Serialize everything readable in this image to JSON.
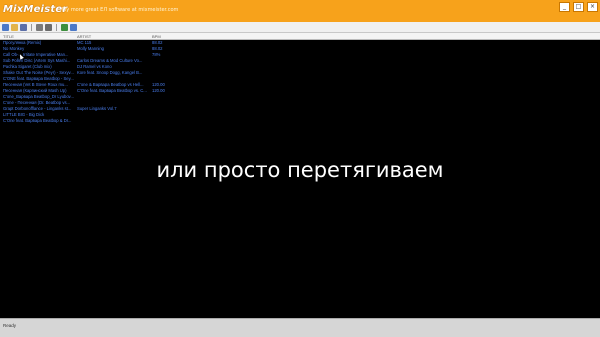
{
  "app": {
    "logo": "MixMeister",
    "tagline": "Fly more great ЕЛ software at mixmeister.com"
  },
  "window_buttons": [
    "_",
    "□",
    "×"
  ],
  "toolbar_icons": [
    {
      "name": "new-icon",
      "color": "#4c79c8"
    },
    {
      "name": "open-icon",
      "color": "#e2b34a"
    },
    {
      "name": "save-icon",
      "color": "#5c6fa8"
    },
    {
      "name": "print-icon",
      "color": "#7a7a7a"
    },
    {
      "name": "settings-icon",
      "color": "#6a6a6a"
    },
    {
      "name": "analyze-icon",
      "color": "#3e8f3e"
    },
    {
      "name": "help-icon",
      "color": "#4c79c8"
    }
  ],
  "columns": {
    "title": "TITLE",
    "artist": "ARTIST",
    "bpm": "BPM"
  },
  "tracks": [
    {
      "title": "Прогулянка (Remix)",
      "artist": "MC 115",
      "bpm": "88.02"
    },
    {
      "title": "No Monkey",
      "artist": "Molly Manning",
      "bpm": "88.02"
    },
    {
      "title": "Call Ob-... Irritate Imperative Man...",
      "artist": "",
      "bpm": "78%"
    },
    {
      "title": "Sub Pollen Disc (Artem Sys Mashi...",
      "artist": "Carlos Dreams & Mod Culture Vo...",
      "bpm": ""
    },
    {
      "title": "Pachka Sigaret (Club mix)",
      "artist": "DJ Ramel vs Kono",
      "bpm": ""
    },
    {
      "title": "Shake Out The Noise (Peyr) - Sexyv...",
      "artist": "Kore feat. Snoop Dogg, Kangel B...",
      "bpm": ""
    },
    {
      "title": "C'ONE feat. Варвара Beatbop - Sey...",
      "artist": "",
      "bpm": ""
    },
    {
      "title": "Песенная (Vet B Steve Roux mu...",
      "artist": "C'one & Варвара Beatbop vs Hell...",
      "bpm": "120.00"
    },
    {
      "title": "Песенная (Карпинский Mash Up)",
      "artist": "C'One feat. Варвара Beatbop vs. C...",
      "bpm": "120.00"
    },
    {
      "title": "C'one_Варвара Beatbop_Dr Lyubov...",
      "artist": "",
      "bpm": ""
    },
    {
      "title": "C'one - Песенная (Dr. Beatbop vs...",
      "artist": "",
      "bpm": ""
    },
    {
      "title": "Grapt Dorbonofflance - Linganks st...",
      "artist": "Super Linganks Vol.7",
      "bpm": ""
    },
    {
      "title": "LITTLE BIG - Big Dick",
      "artist": "",
      "bpm": ""
    },
    {
      "title": "C'One feat. Варвара Beatbop & Dr...",
      "artist": "",
      "bpm": ""
    }
  ],
  "overlay_caption": "или просто перетягиваем",
  "status": "Ready"
}
